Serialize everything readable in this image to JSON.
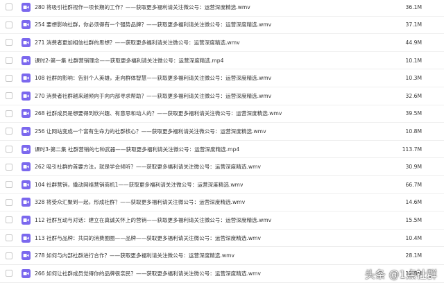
{
  "accent_color": "#7b68ee",
  "row_icon": "video-file-icon",
  "files": [
    {
      "name": "280 将吸引社群视作一项长期的工作？——获取更多福利请关注微公号：运营深度精选.wmv",
      "size": "36.1M"
    },
    {
      "name": "254 要想影响社群，你必须得有一个强势品牌？——获取更多福利请关注微公号：运营深度精选.wmv",
      "size": "37.1M"
    },
    {
      "name": "271 消费者更加相信社群的思想？——获取更多福利请关注微公号：运营深度精选.wmv",
      "size": "44.9M"
    },
    {
      "name": "课时2-第一集 社群营销理念——获取更多福利请关注微公号：运营深度精选.mp4",
      "size": "10.1M"
    },
    {
      "name": "108 社群的影响：告别个人英雄，走向群体智慧——获取更多福利请关注微公号：运营深度精选.wmv",
      "size": "10.3M"
    },
    {
      "name": "270 消费者社群越来越倾向于向内部寻求帮助？——获取更多福利请关注微公号：运营深度精选.wmv",
      "size": "32.6M"
    },
    {
      "name": "268 社群成员是想要得到欣兴趣、有意思和动人的？——获取更多福利请关注微公号：运营深度精选.wmv",
      "size": "39.5M"
    },
    {
      "name": "256 让网站变成一个富有生命力的社群核心？——获取更多福利请关注微公号：运营深度精选.wmv",
      "size": "10.8M"
    },
    {
      "name": "课时3-第二集 社群营销的七种武器——获取更多福利请关注微公号：运营深度精选.mp4",
      "size": "113.7M"
    },
    {
      "name": "262 吸引社群的首要方法，就是学会倾听？——获取更多福利请关注微公号：运营深度精选.wmv",
      "size": "30.9M"
    },
    {
      "name": "104 社群营销，撬动网络营销商机1——获取更多福利请关注微公号：运营深度精选.wmv",
      "size": "66.7M"
    },
    {
      "name": "328 将受众汇聚到一起，形成社群？——获取更多福利请关注微公号：运营深度精选.wmv",
      "size": "14.6M"
    },
    {
      "name": "112 社群互动与对话：建立在真诚关怀上的营销——获取更多福利请关注微公号：运营深度精选.wmv",
      "size": "15.5M"
    },
    {
      "name": "113 社群与品牌：共同的消费圈圈——品牌——获取更多福利请关注微公号：运营深度精选.wmv",
      "size": "10.4M"
    },
    {
      "name": "278 如何与内部社群进行合作？——获取更多福利请关注微公号：运营深度精选.wmv",
      "size": "28.1M"
    },
    {
      "name": "266 如何让社群成员觉得你的品牌很亲民？——获取更多福利请关注微公号：运营深度精选.wmv",
      "size": "12.8M"
    }
  ],
  "watermark": "头条 @1点社群"
}
